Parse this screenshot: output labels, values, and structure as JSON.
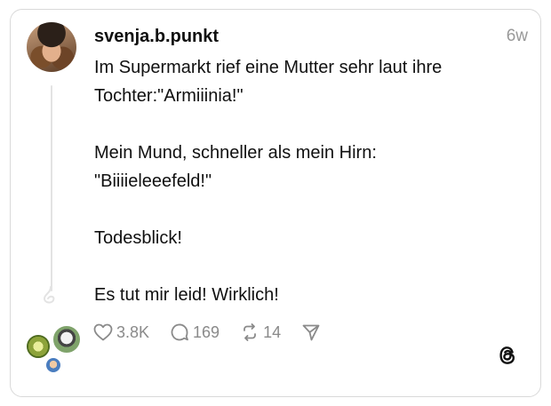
{
  "post": {
    "username": "svenja.b.punkt",
    "time": "6w",
    "lines": [
      "Im Supermarkt rief eine Mutter sehr laut ihre",
      "Tochter:\"Armiiinia!\"",
      "",
      "Mein Mund, schneller als mein Hirn:",
      "\"Biiiieleeefeld!\"",
      "",
      "Todesblick!",
      "",
      "Es tut mir leid! Wirklich!"
    ]
  },
  "actions": {
    "likes": "3.8K",
    "replies": "169",
    "reposts": "14",
    "like_icon": "heart-icon",
    "reply_icon": "speech-bubble-icon",
    "repost_icon": "repost-icon",
    "share_icon": "paper-plane-icon"
  },
  "branding": {
    "logo": "threads-logo"
  },
  "colors": {
    "text": "#101010",
    "muted": "#999999",
    "border": "#d9d9d9"
  }
}
